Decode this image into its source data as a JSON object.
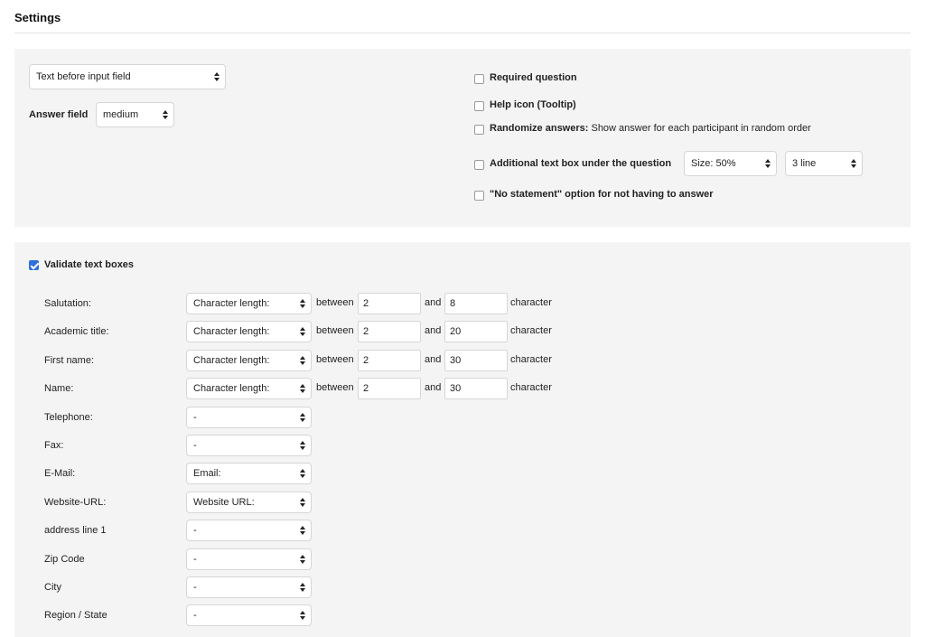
{
  "settings": {
    "title": "Settings",
    "text_position": "Text before input field",
    "answer_field_label": "Answer field",
    "answer_field_value": "medium",
    "options": {
      "required": "Required question",
      "help_icon": "Help icon (Tooltip)",
      "randomize_bold": "Randomize answers:",
      "randomize_rest": " Show answer for each participant in random order",
      "additional_text": "Additional text box under the question",
      "size_value": "Size: 50%",
      "lines_value": "3 line",
      "no_statement": "\"No statement\" option for not having to answer"
    }
  },
  "validation": {
    "title": "Validate text boxes",
    "checked": true,
    "between": "between",
    "and": "and",
    "character": "character",
    "rows": [
      {
        "label": "Salutation:",
        "type": "Character length:",
        "min": "2",
        "max": "8"
      },
      {
        "label": "Academic title:",
        "type": "Character length:",
        "min": "2",
        "max": "20"
      },
      {
        "label": "First name:",
        "type": "Character length:",
        "min": "2",
        "max": "30"
      },
      {
        "label": "Name:",
        "type": "Character length:",
        "min": "2",
        "max": "30"
      },
      {
        "label": "Telephone:",
        "type": "-"
      },
      {
        "label": "Fax:",
        "type": "-"
      },
      {
        "label": "E-Mail:",
        "type": "Email:"
      },
      {
        "label": "Website-URL:",
        "type": "Website URL:"
      },
      {
        "label": "address line 1",
        "type": "-"
      },
      {
        "label": "Zip Code",
        "type": "-"
      },
      {
        "label": "City",
        "type": "-"
      },
      {
        "label": "Region / State",
        "type": "-"
      }
    ]
  }
}
